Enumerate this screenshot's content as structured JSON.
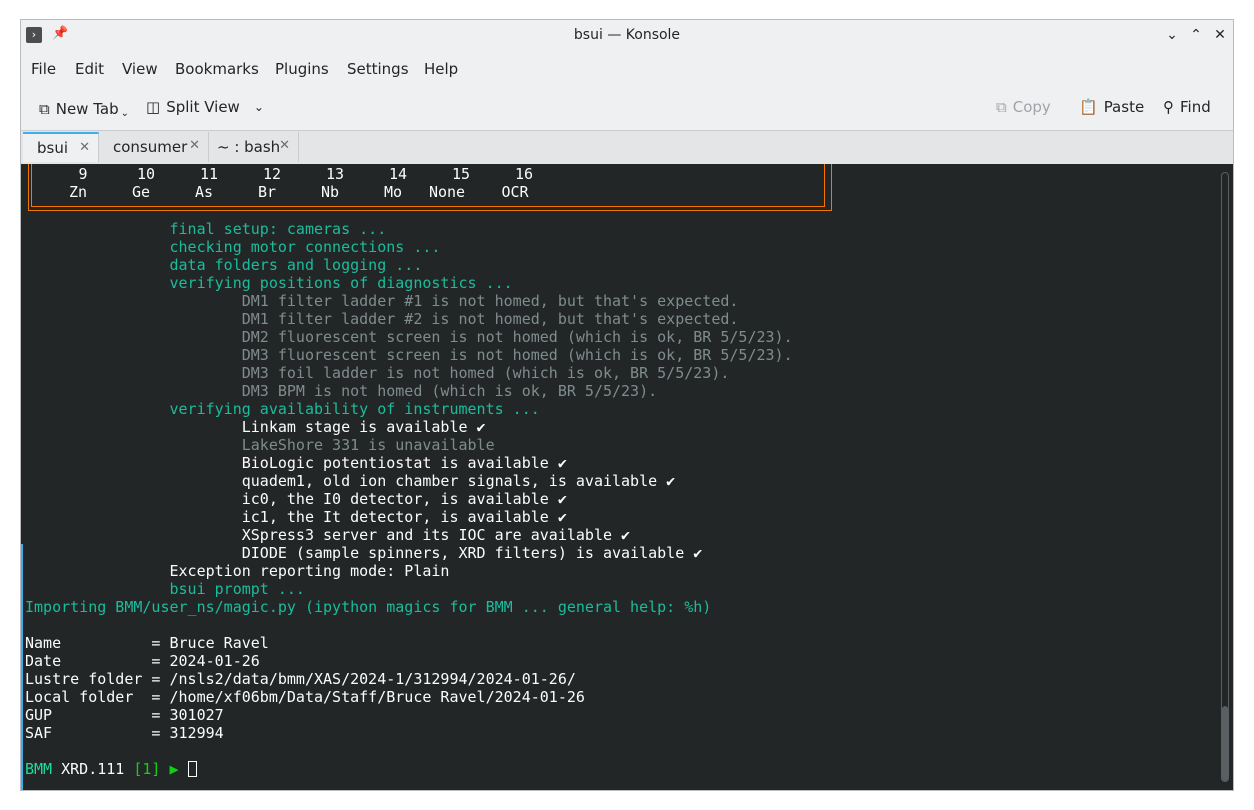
{
  "window": {
    "title": "bsui — Konsole"
  },
  "menu": [
    "File",
    "Edit",
    "View",
    "Bookmarks",
    "Plugins",
    "Settings",
    "Help"
  ],
  "toolbar": {
    "new_tab": "New Tab",
    "split_view": "Split View",
    "copy": "Copy",
    "paste": "Paste",
    "find": "Find"
  },
  "tabs": [
    "bsui",
    "consumer",
    "~ : bash"
  ],
  "elements": {
    "numbers": [
      "9",
      "10",
      "11",
      "12",
      "13",
      "14",
      "15",
      "16"
    ],
    "symbols": [
      "Zn",
      "Ge",
      "As",
      "Br",
      "Nb",
      "Mo",
      "None",
      "OCR"
    ]
  },
  "terminal": {
    "lines": [
      {
        "text": "                final setup: cameras ...",
        "color": "teal"
      },
      {
        "text": "                checking motor connections ...",
        "color": "teal"
      },
      {
        "text": "                data folders and logging ...",
        "color": "teal"
      },
      {
        "text": "                verifying positions of diagnostics ...",
        "color": "teal"
      },
      {
        "text": "                        DM1 filter ladder #1 is not homed, but that's expected.",
        "color": "gray"
      },
      {
        "text": "                        DM1 filter ladder #2 is not homed, but that's expected.",
        "color": "gray"
      },
      {
        "text": "                        DM2 fluorescent screen is not homed (which is ok, BR 5/5/23).",
        "color": "gray"
      },
      {
        "text": "                        DM3 fluorescent screen is not homed (which is ok, BR 5/5/23).",
        "color": "gray"
      },
      {
        "text": "                        DM3 foil ladder is not homed (which is ok, BR 5/5/23).",
        "color": "gray"
      },
      {
        "text": "                        DM3 BPM is not homed (which is ok, BR 5/5/23).",
        "color": "gray"
      },
      {
        "text": "                verifying availability of instruments ...",
        "color": "teal"
      },
      {
        "text": "                        Linkam stage is available ✔",
        "color": "white"
      },
      {
        "text": "                        LakeShore 331 is unavailable",
        "color": "gray"
      },
      {
        "text": "                        BioLogic potentiostat is available ✔",
        "color": "white"
      },
      {
        "text": "                        quadem1, old ion chamber signals, is available ✔",
        "color": "white"
      },
      {
        "text": "                        ic0, the I0 detector, is available ✔",
        "color": "white"
      },
      {
        "text": "                        ic1, the It detector, is available ✔",
        "color": "white"
      },
      {
        "text": "                        XSpress3 server and its IOC are available ✔",
        "color": "white"
      },
      {
        "text": "                        DIODE (sample spinners, XRD filters) is available ✔",
        "color": "white"
      },
      {
        "text": "                Exception reporting mode: Plain",
        "color": "white"
      },
      {
        "text": "                bsui prompt ...",
        "color": "teal"
      },
      {
        "text": "Importing BMM/user_ns/magic.py (ipython magics for BMM ... general help: %h)",
        "color": "teal"
      },
      {
        "text": "",
        "color": "white"
      },
      {
        "text": "Name          = Bruce Ravel",
        "color": "white"
      },
      {
        "text": "Date          = 2024-01-26",
        "color": "white"
      },
      {
        "text": "Lustre folder = /nsls2/data/bmm/XAS/2024-1/312994/2024-01-26/",
        "color": "white"
      },
      {
        "text": "Local folder  = /home/xf06bm/Data/Staff/Bruce Ravel/2024-01-26",
        "color": "white"
      },
      {
        "text": "GUP           = 301027",
        "color": "white"
      },
      {
        "text": "SAF           = 312994",
        "color": "white"
      },
      {
        "text": "",
        "color": "white"
      }
    ],
    "prompt": {
      "profile": "BMM",
      "name": "XRD.111",
      "counter": "[1]",
      "arrow": "▶"
    }
  },
  "colors": {
    "terminal_bg": "#232627",
    "teal": "#1abc9c",
    "gray": "#7f8c8d",
    "box_border": "#f67400",
    "accent": "#3daee9"
  }
}
